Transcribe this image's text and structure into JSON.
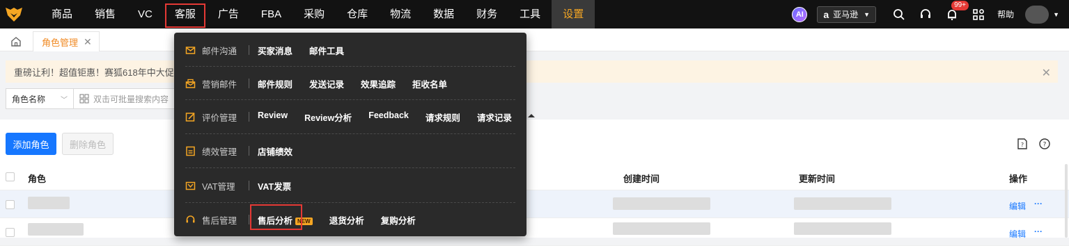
{
  "brand": {
    "accent": "#f5a623",
    "primary": "#1677ff",
    "highlight": "#e53935"
  },
  "nav": {
    "items": [
      {
        "label": "商品"
      },
      {
        "label": "销售"
      },
      {
        "label": "VC"
      },
      {
        "label": "客服"
      },
      {
        "label": "广告"
      },
      {
        "label": "FBA"
      },
      {
        "label": "采购"
      },
      {
        "label": "仓库"
      },
      {
        "label": "物流"
      },
      {
        "label": "数据"
      },
      {
        "label": "财务"
      },
      {
        "label": "工具"
      },
      {
        "label": "设置"
      }
    ],
    "ai_label": "AI",
    "store": {
      "icon_char": "a",
      "label": "亚马逊"
    },
    "notify_count": "99+",
    "help_label": "帮助"
  },
  "tabs": {
    "role_tab": "角色管理"
  },
  "notice": {
    "text": "重磅让利！超值钜惠！赛狐618年中大促来啦"
  },
  "filter": {
    "field": "角色名称",
    "placeholder": "双击可批量搜索内容"
  },
  "buttons": {
    "add": "添加角色",
    "delete": "删除角色"
  },
  "table": {
    "headers": {
      "role": "角色",
      "created": "创建时间",
      "updated": "更新时间",
      "actions": "操作"
    },
    "rows": [
      {
        "edit": "编辑",
        "more": "···"
      },
      {
        "edit": "编辑",
        "more": "···"
      }
    ]
  },
  "menu": {
    "groups": [
      {
        "icon": "mail-icon",
        "label": "邮件沟通",
        "links": [
          "买家消息",
          "邮件工具"
        ]
      },
      {
        "icon": "marketing-mail-icon",
        "label": "营销邮件",
        "links": [
          "邮件规则",
          "发送记录",
          "效果追踪",
          "拒收名单"
        ]
      },
      {
        "icon": "review-edit-icon",
        "label": "评价管理",
        "links": [
          "Review",
          "Review分析",
          "Feedback",
          "请求规则",
          "请求记录"
        ]
      },
      {
        "icon": "performance-icon",
        "label": "绩效管理",
        "links": [
          "店铺绩效"
        ]
      },
      {
        "icon": "vat-icon",
        "label": "VAT管理",
        "links": [
          "VAT发票"
        ]
      },
      {
        "icon": "headset-icon",
        "label": "售后管理",
        "links": [
          "售后分析",
          "退货分析",
          "复购分析"
        ],
        "new_tag": "NEW"
      }
    ]
  }
}
